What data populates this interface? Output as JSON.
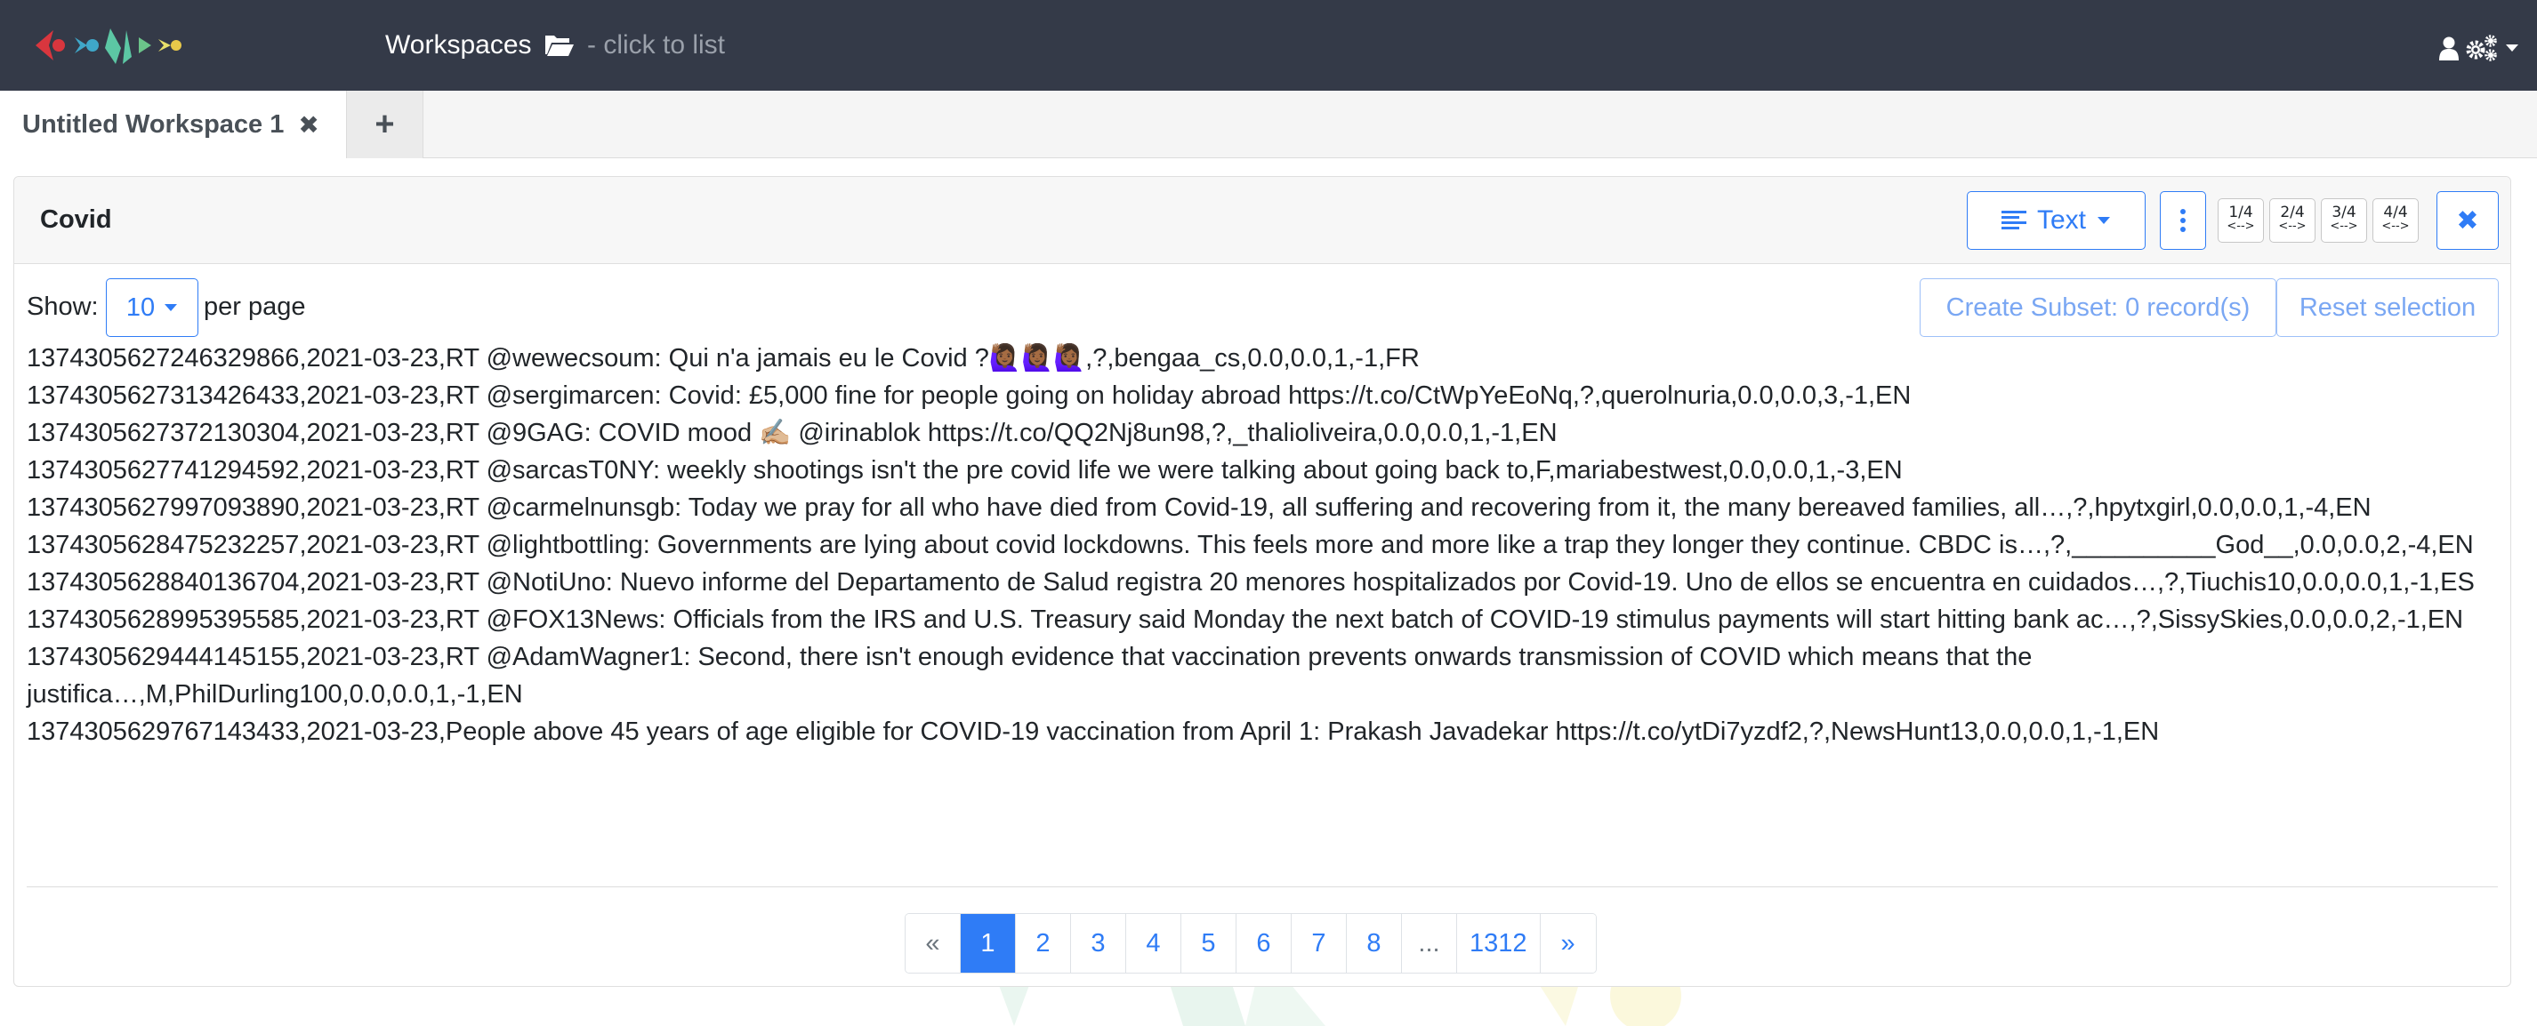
{
  "navbar": {
    "workspaces_label": "Workspaces",
    "workspaces_hint": "- click to list",
    "user_icon": "user-icon",
    "settings_icon": "gears-icon"
  },
  "tabs": {
    "active_label": "Untitled Workspace 1",
    "close_glyph": "✖",
    "add_glyph": "+"
  },
  "card": {
    "title": "Covid",
    "view_button": "Text",
    "split_buttons": [
      "1/4",
      "2/4",
      "3/4",
      "4/4"
    ],
    "split_arrow": "<-->",
    "close_glyph": "✖"
  },
  "controls": {
    "show_label": "Show:",
    "per_page_value": "10",
    "per_page_label": "per page",
    "create_subset_label": "Create Subset: 0 record(s)",
    "reset_selection_label": "Reset selection"
  },
  "records": [
    "1374305627246329866,2021-03-23,RT @wewecsoum: Qui n'a jamais eu le Covid ?🙋🏾‍♀️🙋🏾‍♀️🙋🏾‍♀️,?,bengaa_cs,0.0,0.0,1,-1,FR",
    "1374305627313426433,2021-03-23,RT @sergimarcen: Covid: £5,000 fine for people going on holiday abroad https://t.co/CtWpYeEoNq,?,querolnuria,0.0,0.0,3,-1,EN",
    "1374305627372130304,2021-03-23,RT @9GAG: COVID mood ✍🏼 @irinablok https://t.co/QQ2Nj8un98,?,_thalioliveira,0.0,0.0,1,-1,EN",
    "1374305627741294592,2021-03-23,RT @sarcasT0NY: weekly shootings isn't the pre covid life we were talking about going back to,F,mariabestwest,0.0,0.0,1,-3,EN",
    "1374305627997093890,2021-03-23,RT @carmelnunsgb: Today we pray for all who have died from Covid-19, all suffering and recovering from it, the many bereaved families, all…,?,hpytxgirl,0.0,0.0,1,-4,EN",
    "1374305628475232257,2021-03-23,RT @lightbottling: Governments are lying about covid lockdowns. This feels more and more like a trap they longer they continue. CBDC is…,?,__________God__,0.0,0.0,2,-4,EN",
    "1374305628840136704,2021-03-23,RT @NotiUno: Nuevo informe del Departamento de Salud registra 20 menores hospitalizados por Covid-19. Uno de ellos se encuentra en cuidados…,?,Tiuchis10,0.0,0.0,1,-1,ES",
    "1374305628995395585,2021-03-23,RT @FOX13News: Officials from the IRS and U.S. Treasury said Monday the next batch of COVID-19 stimulus payments will start hitting bank ac…,?,SissySkies,0.0,0.0,2,-1,EN",
    "1374305629444145155,2021-03-23,RT @AdamWagner1: Second, there isn't enough evidence that vaccination prevents onwards transmission of COVID which means that the justifica…,M,PhilDurling100,0.0,0.0,1,-1,EN",
    "1374305629767143433,2021-03-23,People above 45 years of age eligible for COVID-19 vaccination from April 1: Prakash Javadekar https://t.co/ytDi7yzdf2,?,NewsHunt13,0.0,0.0,1,-1,EN"
  ],
  "pagination": {
    "prev": "«",
    "pages": [
      "1",
      "2",
      "3",
      "4",
      "5",
      "6",
      "7",
      "8",
      "...",
      "1312"
    ],
    "active": "1",
    "next": "»"
  },
  "colors": {
    "navbar": "#343a48",
    "accent": "#2f7cf6"
  }
}
